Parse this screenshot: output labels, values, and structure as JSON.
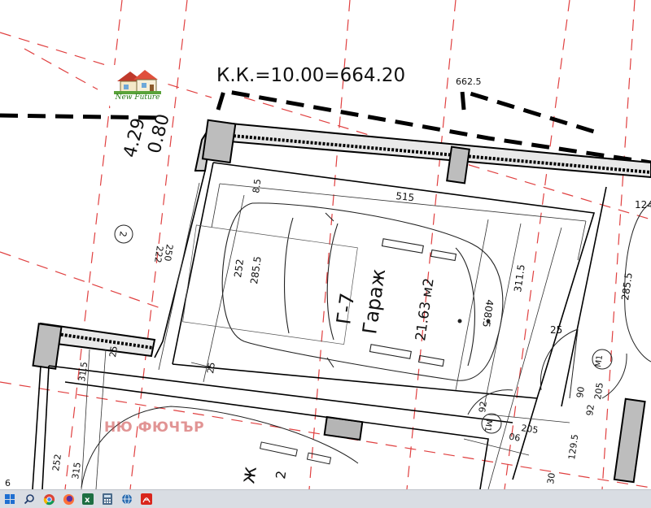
{
  "logo": {
    "text": "New Future"
  },
  "watermark": {
    "text": "НЮ ФЮЧЪР"
  },
  "plan": {
    "header": "К.К.=10.00=664.20",
    "header_side": "662.5",
    "left_dims": [
      "4.29",
      "0.80"
    ],
    "room_code": "Г-7",
    "room_name": "Гараж",
    "room_area": "21.63 м2",
    "dims": {
      "width_515": "515",
      "d85": "8.5",
      "d252": "252",
      "d285": "285.5",
      "d250": "250",
      "d222": "222",
      "d3115": "311.5",
      "d4085": "408.5",
      "d25a": "25",
      "d25b": "25",
      "d25c": "25",
      "d315": "31.5",
      "d2855": "285.5",
      "d124": "124",
      "d205a": "205",
      "d205b": "205",
      "d90a": "90",
      "d90b": "90",
      "d92a": "92",
      "d92b": "92",
      "d1295": "129.5",
      "d252b": "252",
      "d315b": "315",
      "d30": "30",
      "d6": "6"
    },
    "markers": {
      "m1a": "M1",
      "m1b": "M1",
      "circle_label": "2"
    }
  },
  "taskbar": {
    "icons": [
      "windows-start",
      "search",
      "chrome",
      "firefox",
      "excel",
      "calculator",
      "network",
      "pdf-reader"
    ],
    "colors": {
      "chrome": "#db4437",
      "firefox": "#ff7139",
      "excel": "#1d6f42",
      "calculator": "#4a6a8a",
      "network": "#2b6cb0",
      "pdf": "#d9261c"
    }
  }
}
